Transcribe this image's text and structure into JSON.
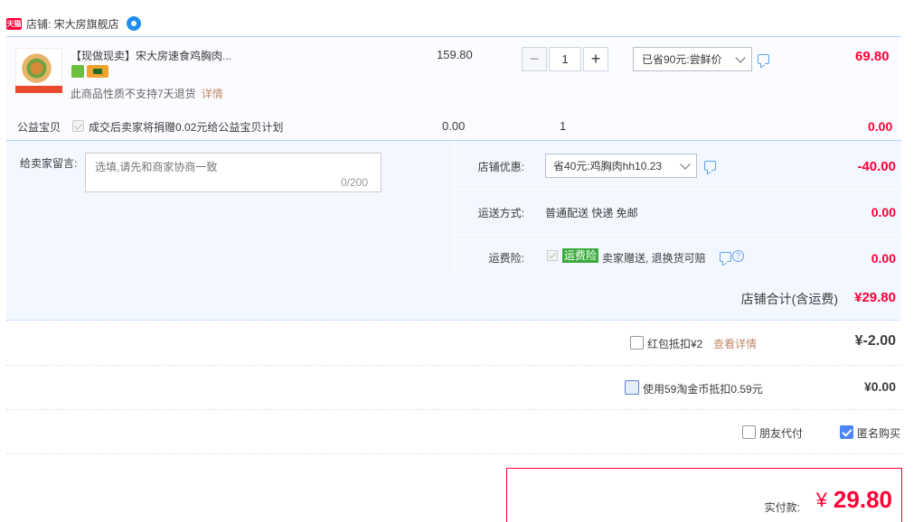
{
  "shop": {
    "logo_text": "天猫",
    "label": "店铺: 宋大房旗舰店"
  },
  "item": {
    "title": "【现做现卖】宋大房速食鸡胸肉...",
    "return_note": "此商品性质不支持7天退货",
    "detail_link": "详情",
    "unit_price": "159.80",
    "quantity": "1",
    "minus_label": "−",
    "plus_label": "+",
    "promo_selected": "已省90元:尝鲜价",
    "total": "69.80"
  },
  "charity": {
    "label": "公益宝贝",
    "text": "成交后卖家将捐赠0.02元给公益宝贝计划",
    "price": "0.00",
    "qty": "1",
    "total": "0.00"
  },
  "message": {
    "label": "给卖家留言:",
    "placeholder": "选填,请先和商家协商一致",
    "counter": "0/200"
  },
  "options": {
    "coupon_label": "店铺优惠:",
    "coupon_selected": "省40元:鸡胸肉hh10.23",
    "coupon_value": "-40.00",
    "shipping_label": "运送方式:",
    "shipping_text": "普通配送 快递 免邮",
    "shipping_value": "0.00",
    "insurance_label": "运费险:",
    "insurance_badge": "运费险",
    "insurance_text": "卖家赠送, 退换货可赔",
    "insurance_value": "0.00",
    "help_glyph": "?"
  },
  "subtotal": {
    "label": "店铺合计(含运费)",
    "value": "¥29.80"
  },
  "discounts": {
    "hongbao_text": "红包抵扣¥2",
    "hongbao_link": "查看详情",
    "hongbao_value": "¥-2.00",
    "coin_text": "使用59淘金币抵扣0.59元",
    "coin_value": "¥0.00",
    "friend_pay": "朋友代付",
    "anonymous": "匿名购买",
    "anonymous_checked": true
  },
  "payment": {
    "label": "实付款:",
    "currency": "¥",
    "value": "29.80"
  },
  "colors": {
    "accent_red": "#ff0036",
    "tmall_red": "#ff0036",
    "link_brown": "#c0896b",
    "check_blue": "#4b85f2",
    "insurance_green": "#3bab3e"
  },
  "icons": [
    "tmall-logo-icon",
    "wangwang-chat-icon",
    "comment-icon",
    "chevron-down-icon",
    "help-icon",
    "checkmark-icon"
  ]
}
